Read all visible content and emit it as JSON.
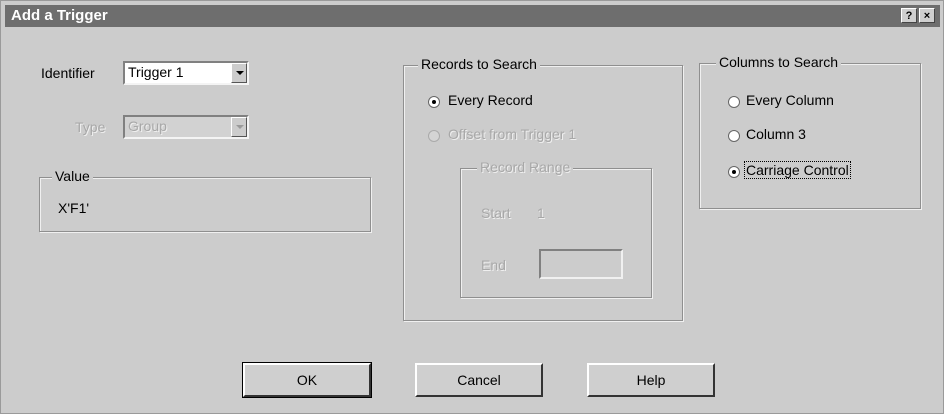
{
  "window": {
    "title": "Add a Trigger",
    "help_glyph": "?",
    "close_glyph": "×"
  },
  "identifier": {
    "label": "Identifier",
    "value": "Trigger 1"
  },
  "type": {
    "label": "Type",
    "value": "Group"
  },
  "value_group": {
    "title": "Value",
    "text": "X'F1'"
  },
  "records_to_search": {
    "title": "Records to Search",
    "every_record": "Every Record",
    "offset": "Offset from Trigger 1",
    "range": {
      "title": "Record Range",
      "start_label": "Start",
      "start_value": "1",
      "end_label": "End",
      "end_value": ""
    }
  },
  "columns_to_search": {
    "title": "Columns to Search",
    "every_column": "Every Column",
    "column_3": "Column 3",
    "carriage_control": "Carriage Control"
  },
  "buttons": {
    "ok": "OK",
    "cancel": "Cancel",
    "help": "Help"
  }
}
